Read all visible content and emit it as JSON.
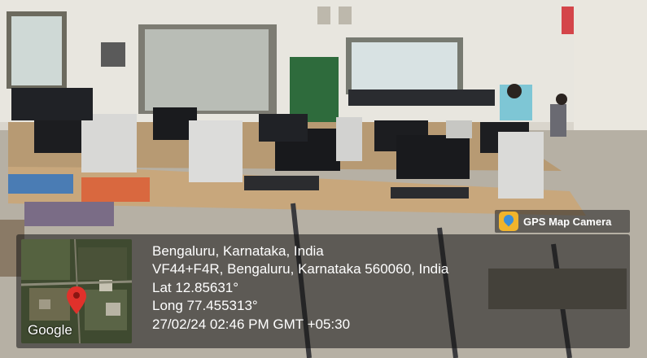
{
  "overlay": {
    "app_name": "GPS Map Camera",
    "map_provider": "Google",
    "location_title": "Bengaluru, Karnataka, India",
    "address": "VF44+F4R, Bengaluru, Karnataka 560060, India",
    "latitude": "Lat 12.85631°",
    "longitude": "Long 77.455313°",
    "datetime": "27/02/24 02:46 PM GMT +05:30"
  },
  "icons": [
    "gps-map-camera-app-icon",
    "map-pin-icon"
  ],
  "colors": {
    "pin": "#e0312b",
    "overlay_text": "#ffffff"
  }
}
